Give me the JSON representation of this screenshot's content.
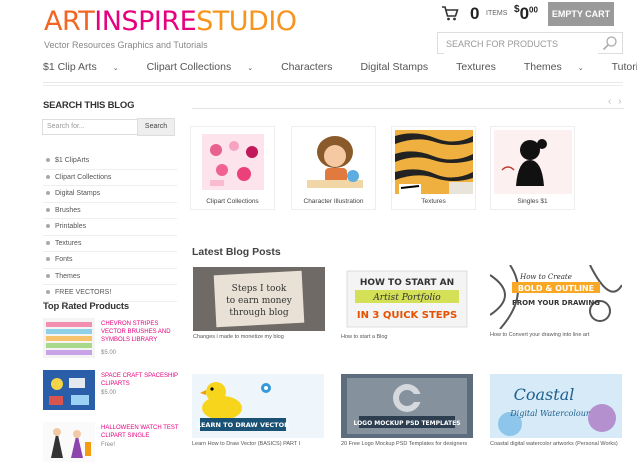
{
  "header": {
    "logo": {
      "part1": "ART",
      "part2": "INSPIRE",
      "part3": "STUDIO"
    },
    "tagline": "Vector Resources Graphics and Tutorials",
    "cart": {
      "count": "0",
      "items_label": "ITEMS",
      "currency": "$",
      "price": "0",
      "cents": "00",
      "empty_label": "EMPTY CART"
    },
    "search_placeholder": "SEARCH FOR PRODUCTS"
  },
  "nav": [
    {
      "label": "$1 Clip Arts",
      "dropdown": true
    },
    {
      "label": "Clipart Collections",
      "dropdown": true
    },
    {
      "label": "Characters",
      "dropdown": false
    },
    {
      "label": "Digital Stamps",
      "dropdown": false
    },
    {
      "label": "Textures",
      "dropdown": false
    },
    {
      "label": "Themes",
      "dropdown": true
    },
    {
      "label": "Tutorials",
      "dropdown": false
    }
  ],
  "sidebar": {
    "search_title": "SEARCH THIS BLOG",
    "search_placeholder": "Search for...",
    "search_button": "Search",
    "categories": [
      "$1 ClipArts",
      "Clipart Collections",
      "Digital Stamps",
      "Brushes",
      "Printables",
      "Textures",
      "Fonts",
      "Themes",
      "FREE VECTORS!"
    ],
    "top_rated_title": "Top Rated Products",
    "products": [
      {
        "name": "CHEVRON STRIPES VECTOR BRUSHES AND SYMBOLS LIBRARY",
        "price": "$5.00"
      },
      {
        "name": "SPACE CRAFT SPACESHIP CLIPARTS",
        "price": "$5.00"
      },
      {
        "name": "HALLOWEEN WATCH TEST CLIPART SINGLE",
        "price": "Free!"
      }
    ]
  },
  "carousel": {
    "arrows": "‹ ›",
    "items": [
      {
        "caption": "Clipart Collections"
      },
      {
        "caption": "Character Illustration"
      },
      {
        "caption": "Textures"
      },
      {
        "caption": "Singles $1"
      }
    ]
  },
  "blog": {
    "title": "Latest Blog Posts",
    "posts": [
      {
        "image_text": "Steps I took to earn money through blog",
        "caption": "Changes i made to monetize my blog"
      },
      {
        "image_text_top": "HOW TO START AN",
        "image_text_mid": "Artist Portfolio",
        "image_text_bottom": "IN 3 QUICK STEPS",
        "caption": "How to start a Blog"
      },
      {
        "image_text_top": "How to Create",
        "image_text_mid": "BOLD & OUTLINE",
        "image_text_bottom": "FROM YOUR DRAWING",
        "caption": "How to Convert your drawing into line art"
      },
      {
        "image_text": "LEARN TO DRAW VECTOR",
        "caption": "Learn How to Draw Vector (BASICS) PART I"
      },
      {
        "image_text": "LOGO MOCKUP PSD TEMPLATES",
        "caption": "20 Free Logo Mockup PSD Templates for designers"
      },
      {
        "image_text_top": "Coastal",
        "image_text_bottom": "Digital Watercolour",
        "caption": "Coastal digital watercolor artworks (Personal Works)"
      }
    ]
  },
  "colors": {
    "orange": "#f26522",
    "pink": "#e6007e",
    "gray_button": "#9a9a9a"
  }
}
